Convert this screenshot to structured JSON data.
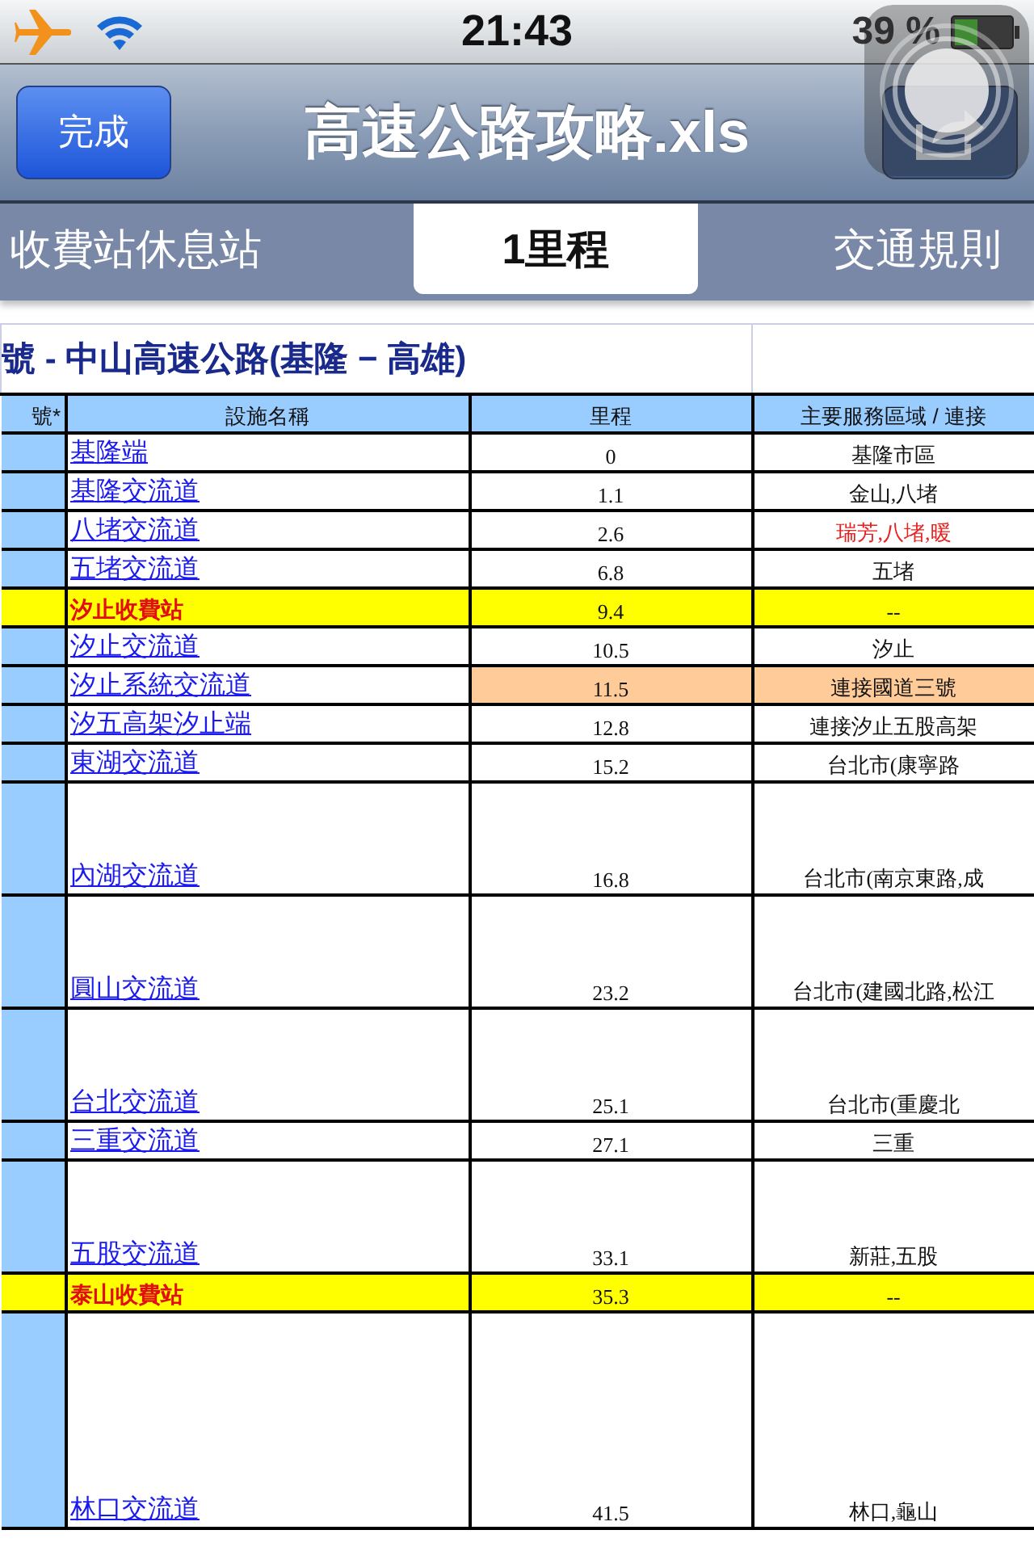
{
  "status_bar": {
    "time": "21:43",
    "battery": "39 %"
  },
  "nav_bar": {
    "done_button": "完成",
    "title": "高速公路攻略.xls"
  },
  "tabs": [
    {
      "label": "收費站休息站",
      "selected": false
    },
    {
      "label": "1里程",
      "selected": true
    },
    {
      "label": "交通規則",
      "selected": false
    }
  ],
  "sheet": {
    "title": "號 - 中山高速公路(基隆 − 高雄)",
    "columns": [
      "號*",
      "設施名稱",
      "里程",
      "主要服務區域 / 連接"
    ],
    "rows": [
      {
        "name": "基隆端",
        "mileage": "0",
        "area": "基隆市區",
        "kind": "interchange",
        "tall": false,
        "extended": false,
        "alert": false
      },
      {
        "name": "基隆交流道",
        "mileage": "1.1",
        "area": "金山,八堵",
        "kind": "interchange",
        "tall": false,
        "extended": false,
        "alert": false
      },
      {
        "name": "八堵交流道",
        "mileage": "2.6",
        "area": "瑞芳,八堵,暖",
        "kind": "interchange",
        "tall": false,
        "extended": false,
        "alert": true
      },
      {
        "name": "五堵交流道",
        "mileage": "6.8",
        "area": "五堵",
        "kind": "interchange",
        "tall": false,
        "extended": false,
        "alert": false
      },
      {
        "name": "汐止收費站",
        "mileage": "9.4",
        "area": "--",
        "kind": "tollbooth",
        "tall": false,
        "extended": false,
        "alert": false
      },
      {
        "name": "汐止交流道",
        "mileage": "10.5",
        "area": "汐止",
        "kind": "interchange",
        "tall": false,
        "extended": false,
        "alert": false
      },
      {
        "name": "汐止系統交流道",
        "mileage": "11.5",
        "area": "連接國道三號",
        "kind": "system",
        "tall": false,
        "extended": false,
        "alert": false
      },
      {
        "name": "汐五高架汐止端",
        "mileage": "12.8",
        "area": "連接汐止五股高架",
        "kind": "interchange",
        "tall": false,
        "extended": false,
        "alert": false
      },
      {
        "name": "東湖交流道",
        "mileage": "15.2",
        "area": "台北市(康寧路",
        "kind": "interchange",
        "tall": false,
        "extended": false,
        "alert": false
      },
      {
        "name": "內湖交流道",
        "mileage": "16.8",
        "area": "台北市(南京東路,成",
        "kind": "interchange",
        "tall": true,
        "extended": false,
        "alert": false
      },
      {
        "name": "圓山交流道",
        "mileage": "23.2",
        "area": "台北市(建國北路,松江",
        "kind": "interchange",
        "tall": true,
        "extended": false,
        "alert": false
      },
      {
        "name": "台北交流道",
        "mileage": "25.1",
        "area": "台北市(重慶北",
        "kind": "interchange",
        "tall": true,
        "extended": false,
        "alert": false
      },
      {
        "name": "三重交流道",
        "mileage": "27.1",
        "area": "三重",
        "kind": "interchange",
        "tall": false,
        "extended": false,
        "alert": false
      },
      {
        "name": "五股交流道",
        "mileage": "33.1",
        "area": "新莊,五股",
        "kind": "interchange",
        "tall": true,
        "extended": false,
        "alert": false
      },
      {
        "name": "泰山收費站",
        "mileage": "35.3",
        "area": "--",
        "kind": "tollbooth",
        "tall": false,
        "extended": false,
        "alert": false
      },
      {
        "name": "林口交流道",
        "mileage": "41.5",
        "area": "林口,龜山",
        "kind": "interchange",
        "tall": false,
        "extended": true,
        "alert": false
      }
    ]
  }
}
